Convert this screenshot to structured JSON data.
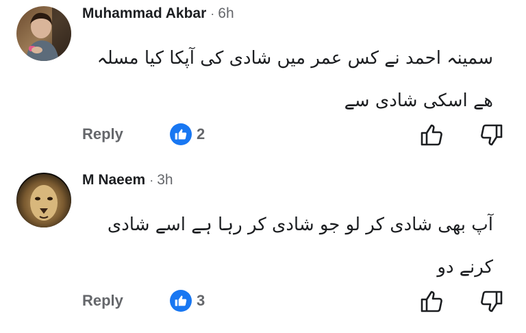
{
  "comments": [
    {
      "author": "Muhammad Akbar",
      "separator": "·",
      "time": "6h",
      "text": "سمینہ احمد نے کس عمر میں شادی کی آپکا کیا مسلہ ھے اسکی شادی سے",
      "reply_label": "Reply",
      "like_count": "2",
      "avatar_icon": "child-photo-avatar"
    },
    {
      "author": "M Naeem",
      "separator": "·",
      "time": "3h",
      "text": "آپ بھی شادی کر لو جو شادی کر رہا ہے اسے شادی کرنے دو",
      "reply_label": "Reply",
      "like_count": "3",
      "avatar_icon": "lion-photo-avatar"
    }
  ],
  "colors": {
    "like_blue": "#1877f2",
    "meta_gray": "#65676b",
    "text_dark": "#1c1e21"
  }
}
